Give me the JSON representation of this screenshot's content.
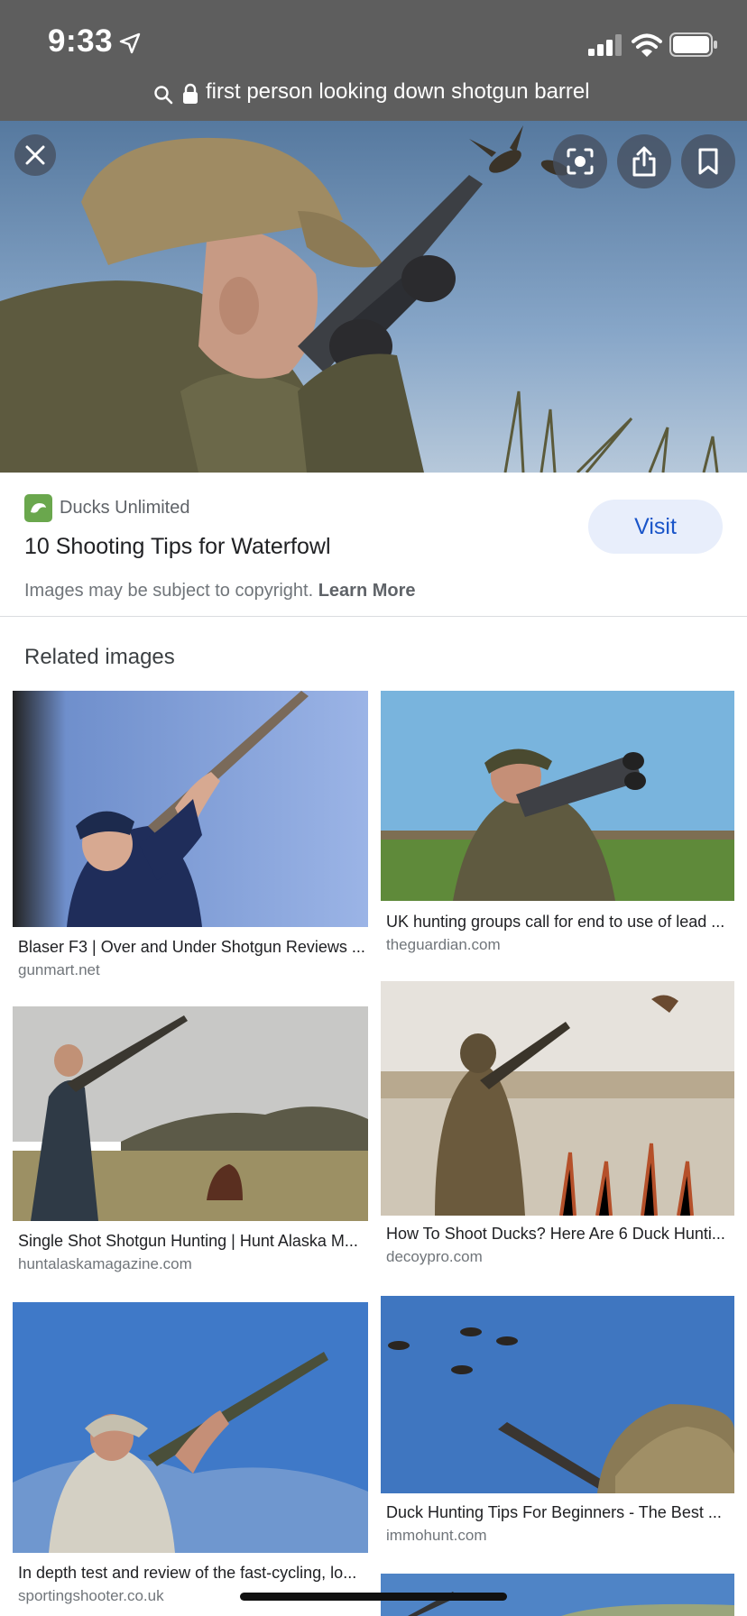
{
  "status_bar": {
    "time": "9:33",
    "icons": [
      "location-arrow-icon",
      "cellular-signal-icon",
      "wifi-icon",
      "battery-icon"
    ]
  },
  "search": {
    "query": "first person looking down shotgun barrel",
    "icons": [
      "search-icon",
      "lock-icon"
    ]
  },
  "viewer": {
    "actions": [
      "close-icon",
      "lens-icon",
      "share-icon",
      "bookmark-icon"
    ],
    "source_name": "Ducks Unlimited",
    "title": "10 Shooting Tips for Waterfowl",
    "visit_label": "Visit",
    "copyright_text": "Images may be subject to copyright.",
    "learn_more_label": "Learn More"
  },
  "related": {
    "heading": "Related images",
    "items": [
      {
        "title": "Blaser F3 | Over and Under Shotgun Reviews ...",
        "domain": "gunmart.net"
      },
      {
        "title": "UK hunting groups call for end to use of lead ...",
        "domain": "theguardian.com"
      },
      {
        "title": "Single Shot Shotgun Hunting | Hunt Alaska M...",
        "domain": "huntalaskamagazine.com"
      },
      {
        "title": "How To Shoot Ducks? Here Are 6 Duck Hunti...",
        "domain": "decoypro.com"
      },
      {
        "title": "In depth test and review of the fast-cycling, lo...",
        "domain": "sportingshooter.co.uk"
      },
      {
        "title": "Duck Hunting Tips For Beginners - The Best ...",
        "domain": "immohunt.com"
      }
    ]
  },
  "colors": {
    "header_bg": "#5e5e5e",
    "visit_bg": "#e8eefb",
    "visit_text": "#1a55c9",
    "source_logo": "#6aa74d"
  }
}
